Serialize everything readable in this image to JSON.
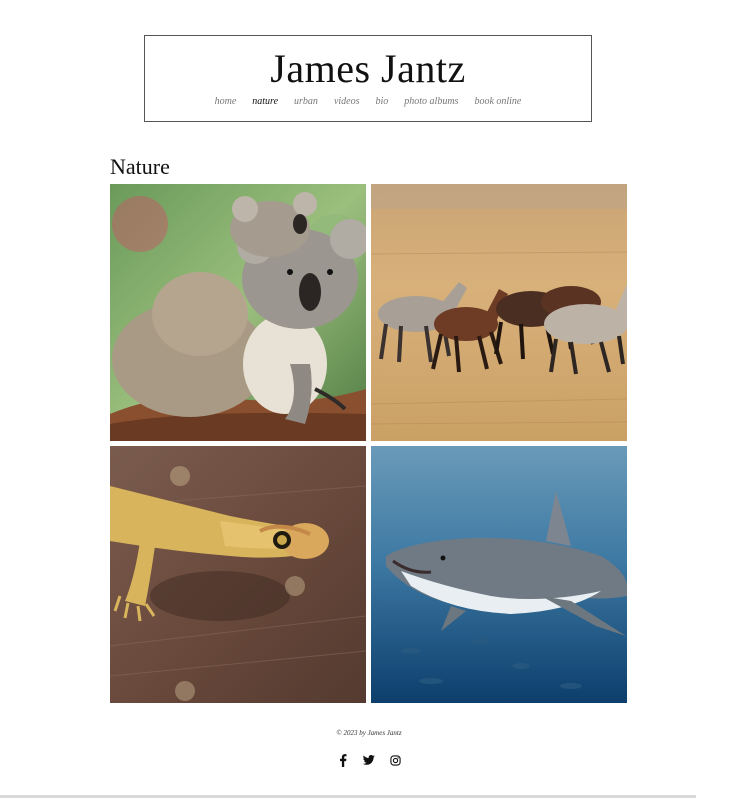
{
  "site": {
    "title": "James Jantz"
  },
  "nav": {
    "items": [
      {
        "label": "home",
        "active": false
      },
      {
        "label": "nature",
        "active": true
      },
      {
        "label": "urban",
        "active": false
      },
      {
        "label": "videos",
        "active": false
      },
      {
        "label": "bio",
        "active": false
      },
      {
        "label": "photo albums",
        "active": false
      },
      {
        "label": "book online",
        "active": false
      }
    ]
  },
  "section": {
    "heading": "Nature"
  },
  "gallery": {
    "images": [
      {
        "subject": "koala-with-baby"
      },
      {
        "subject": "wild-horses-running"
      },
      {
        "subject": "leopard-gecko"
      },
      {
        "subject": "great-white-shark"
      }
    ]
  },
  "footer": {
    "copyright": "© 2023 by James Jantz",
    "social": [
      {
        "icon": "facebook-icon"
      },
      {
        "icon": "twitter-icon"
      },
      {
        "icon": "instagram-icon"
      }
    ]
  }
}
